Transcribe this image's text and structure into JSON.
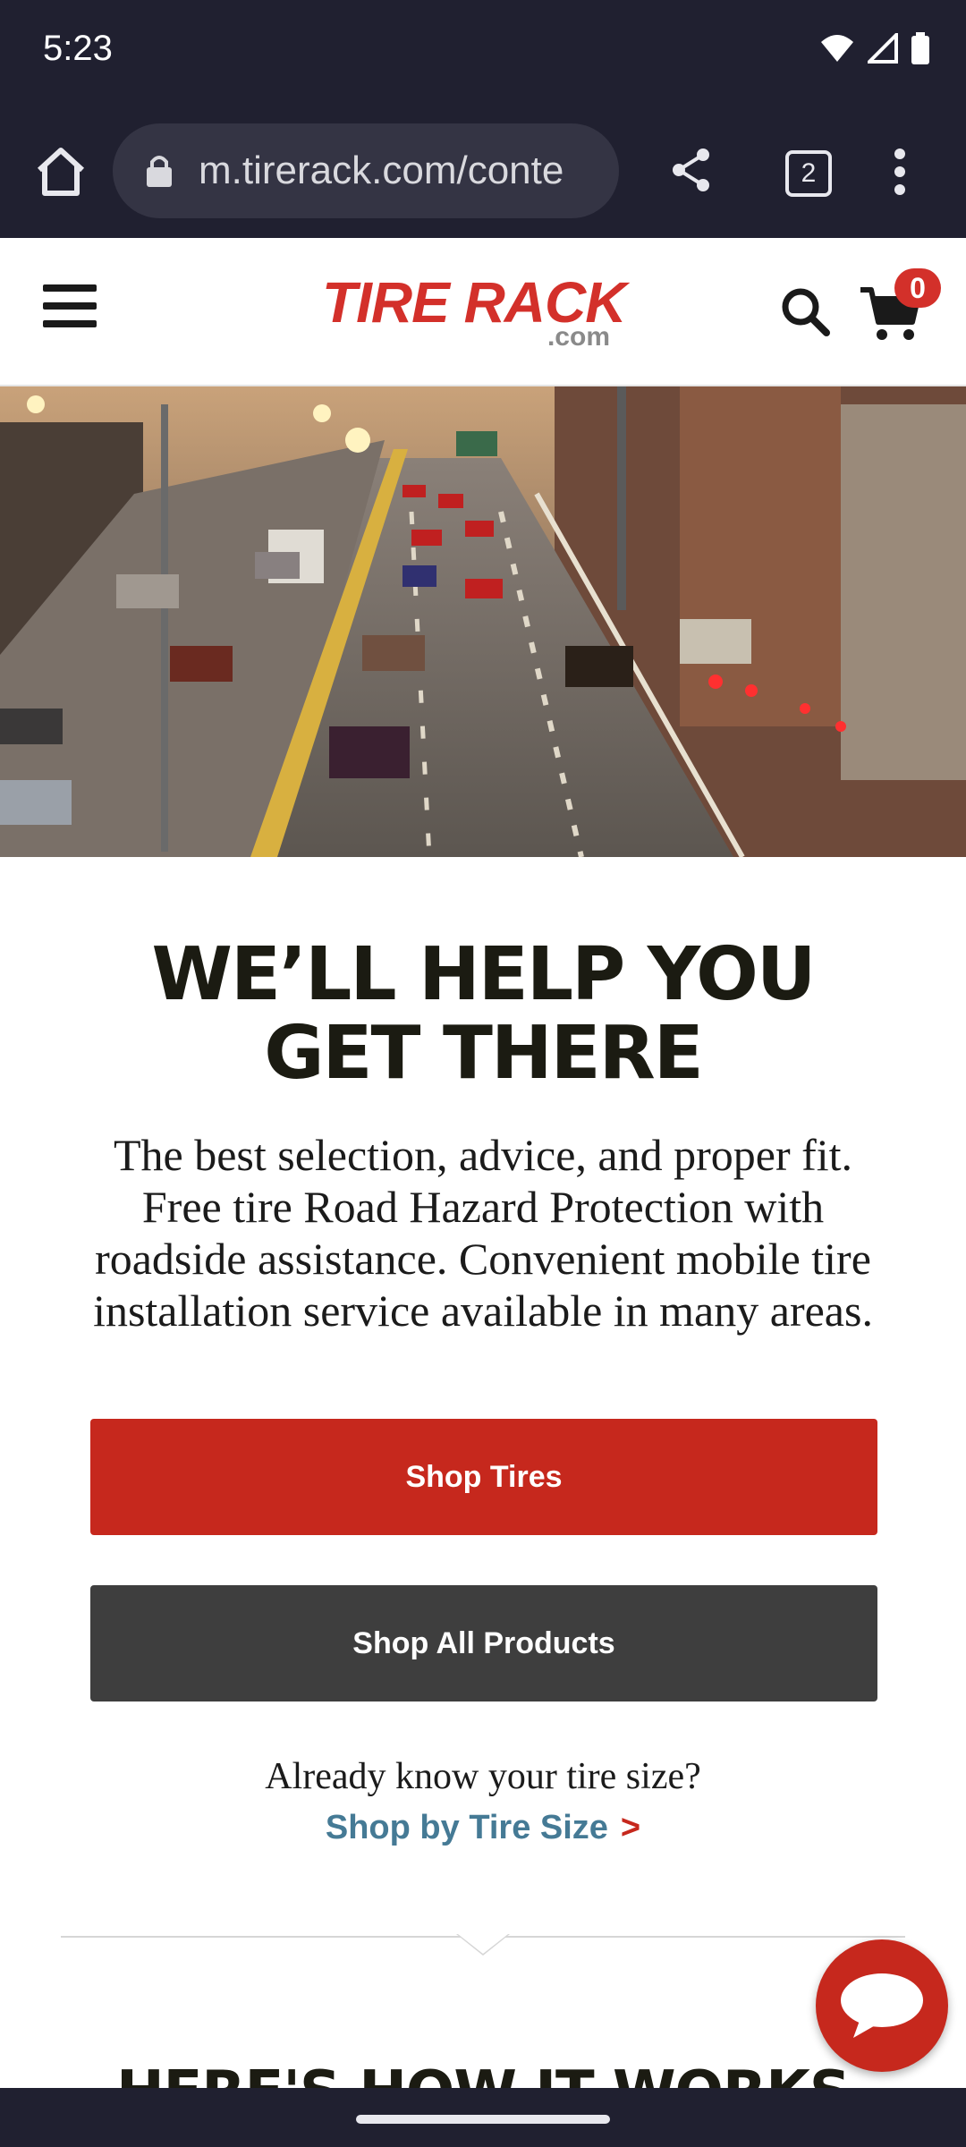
{
  "status_bar": {
    "time": "5:23"
  },
  "browser": {
    "url": "m.tirerack.com/conte",
    "tab_count": "2"
  },
  "site_header": {
    "logo_main": "TIRE RACK",
    "logo_sub": ".com",
    "cart_count": "0"
  },
  "hero_heading_lines": [
    "WE’LL HELP YOU",
    "GET THERE"
  ],
  "description_lines": [
    "The best selection, advice, and proper fit.",
    "Free tire Road Hazard Protection with",
    "roadside assistance. Convenient mobile tire",
    "installation service available in many areas."
  ],
  "buttons": {
    "shop_tires": "Shop Tires",
    "shop_all": "Shop All Products"
  },
  "tire_size": {
    "question": "Already know your tire size?",
    "link": "Shop by Tire Size",
    "arrow": ">"
  },
  "next_section_heading": "HERE'S HOW IT WORKS",
  "colors": {
    "brand_red": "#c6281d",
    "dark_button": "#3e3e3e",
    "link_blue": "#457a95",
    "chrome_bar": "#202030"
  }
}
